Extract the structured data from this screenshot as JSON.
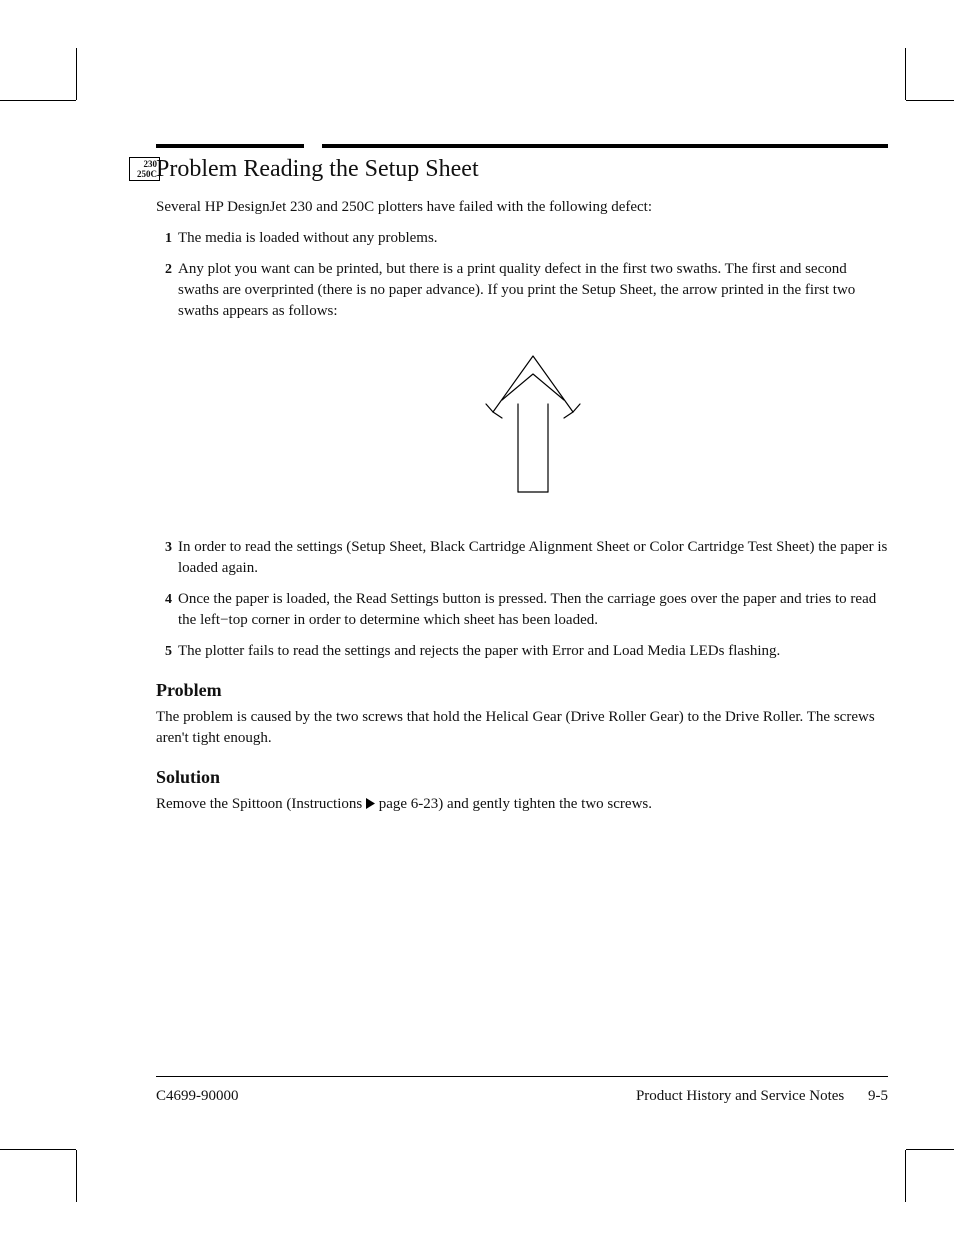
{
  "model_badge": {
    "line1": "230",
    "line2": "250C"
  },
  "title": "Problem Reading the Setup Sheet",
  "intro": "Several HP DesignJet 230 and 250C plotters have failed with the following defect:",
  "steps": [
    {
      "n": "1",
      "text": "The media is loaded without any problems."
    },
    {
      "n": "2",
      "text": "Any plot you want can be printed, but there is a print quality defect in the first two swaths. The first and second swaths are overprinted (there is no paper advance). If you print the Setup Sheet, the arrow printed in the first two swaths appears as follows:"
    },
    {
      "n": "3",
      "text": "In order to read the settings (Setup Sheet, Black Cartridge Alignment Sheet or Color Cartridge Test Sheet) the paper is loaded again."
    },
    {
      "n": "4",
      "text": "Once the paper is loaded, the Read Settings button is pressed. Then the carriage goes over the paper and tries to read the left−top corner in order to determine which sheet has been loaded."
    },
    {
      "n": "5",
      "text": "The plotter fails to read the settings and rejects the paper with Error and Load Media LEDs flashing."
    }
  ],
  "problem": {
    "heading": "Problem",
    "text": "The problem is caused by the two screws that hold the Helical Gear (Drive Roller Gear) to the Drive Roller. The screws aren't tight enough."
  },
  "solution": {
    "heading": "Solution",
    "text_before": "Remove the Spittoon (Instructions ",
    "page_ref": " page 6-23) and gently tighten the two screws."
  },
  "footer": {
    "left": "C4699-90000",
    "right_title": "Product History and Service Notes",
    "right_page": "9-5"
  }
}
